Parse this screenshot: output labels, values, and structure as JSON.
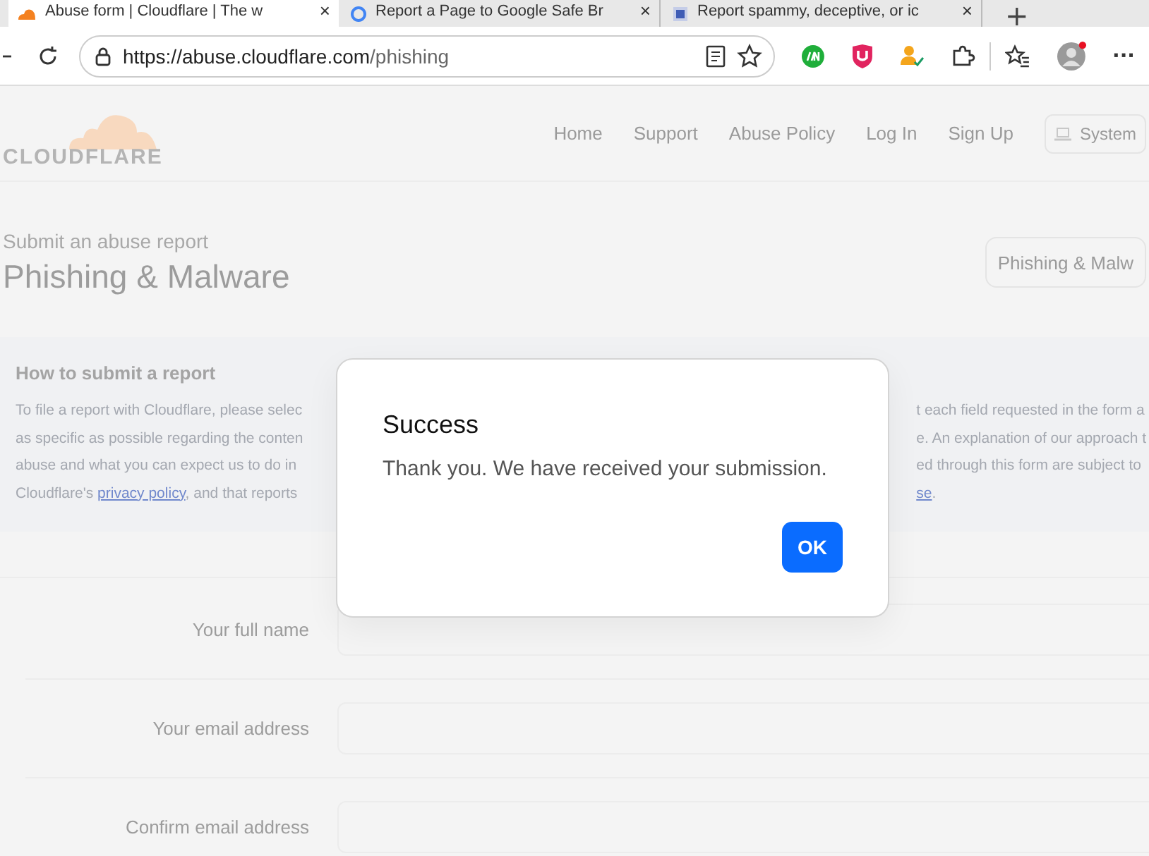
{
  "browser": {
    "tabs": [
      {
        "title": "Abuse form | Cloudflare | The w",
        "selected": true,
        "close": "×"
      },
      {
        "title": "Report a Page to Google Safe Br",
        "selected": false,
        "close": "×"
      },
      {
        "title": "Report spammy, deceptive, or ic",
        "selected": false,
        "close": "×"
      }
    ],
    "new_tab": "+",
    "url_host": "https://abuse.cloudflare.com",
    "url_path": "/phishing",
    "more": "···"
  },
  "site": {
    "logo": "CLOUDFLARE",
    "nav": [
      "Home",
      "Support",
      "Abuse Policy",
      "Log In",
      "Sign Up"
    ],
    "theme_button": "System"
  },
  "page": {
    "kicker": "Submit an abuse report",
    "title": "Phishing & Malware",
    "report_type": "Phishing & Malw"
  },
  "info": {
    "heading": "How to submit a report",
    "left_lines": [
      "To file a report with Cloudflare, please selec",
      "as specific as possible regarding the conten",
      "abuse and what you can expect us to do in"
    ],
    "last_left": {
      "before": "Cloudflare's ",
      "link": "privacy policy",
      "after": ", and that reports"
    },
    "right_lines": [
      "t each field requested in the form a",
      "e. An explanation of our approach t",
      "ed through this form are subject to"
    ],
    "last_right": {
      "link": "se",
      "after": "."
    }
  },
  "form": {
    "fields": [
      {
        "label": "Your full name"
      },
      {
        "label": "Your email address"
      },
      {
        "label": "Confirm email address"
      }
    ]
  },
  "dialog": {
    "title": "Success",
    "message": "Thank you. We have received your submission.",
    "button": "OK"
  }
}
